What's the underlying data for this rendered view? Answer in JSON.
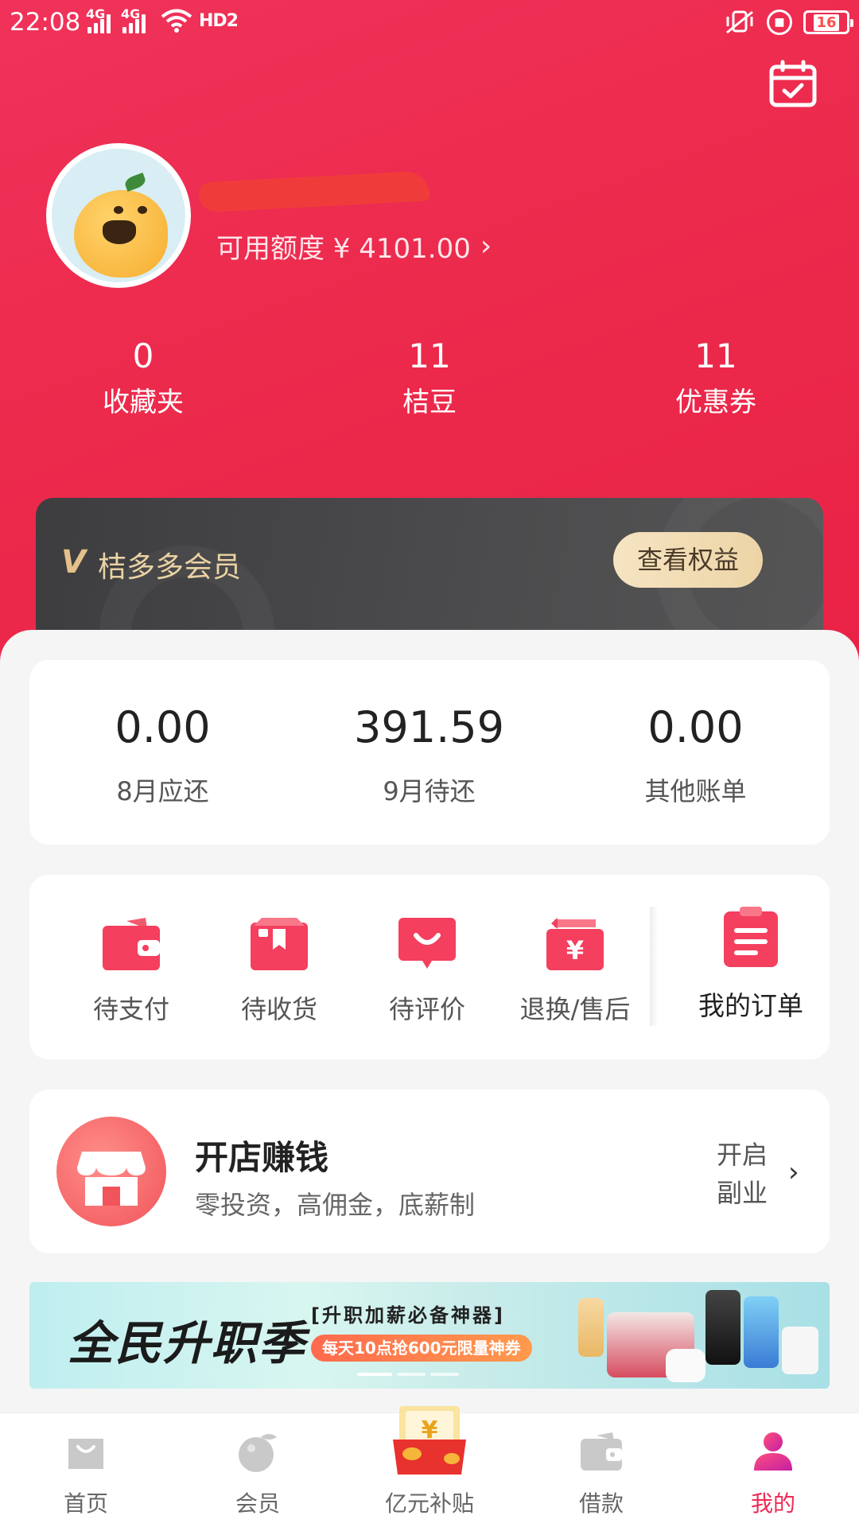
{
  "status_bar": {
    "time": "22:08",
    "signal_1": "4G",
    "signal_2": "4G",
    "hd": "HD2",
    "battery": "16"
  },
  "header": {
    "calendar_icon": "calendar-check-icon",
    "credit_label": "可用额度 ¥ 4101.00",
    "chevron": "›"
  },
  "stats": [
    {
      "value": "0",
      "label": "收藏夹"
    },
    {
      "value": "11",
      "label": "桔豆"
    },
    {
      "value": "11",
      "label": "优惠券"
    }
  ],
  "vip": {
    "logo": "V",
    "title": "桔多多会员",
    "button": "查看权益"
  },
  "bills": [
    {
      "amount": "0.00",
      "label": "8月应还"
    },
    {
      "amount": "391.59",
      "label": "9月待还"
    },
    {
      "amount": "0.00",
      "label": "其他账单"
    }
  ],
  "orders": {
    "items": [
      {
        "label": "待支付",
        "icon": "wallet-icon"
      },
      {
        "label": "待收货",
        "icon": "package-icon"
      },
      {
        "label": "待评价",
        "icon": "comment-icon"
      },
      {
        "label": "退换/售后",
        "icon": "refund-icon"
      }
    ],
    "my_orders": "我的订单"
  },
  "shop": {
    "title": "开店赚钱",
    "subtitle": "零投资，高佣金，底薪制",
    "action_line1": "开启",
    "action_line2": "副业",
    "chevron": "›"
  },
  "banner": {
    "title": "全民升职季",
    "subtitle": "[升职加薪必备神器]",
    "tag": "每天10点抢600元限量神券"
  },
  "tabbar": [
    {
      "label": "首页",
      "icon": "shopping-bag-icon",
      "active": false
    },
    {
      "label": "会员",
      "icon": "orange-icon",
      "active": false
    },
    {
      "label": "亿元补贴",
      "icon": "red-envelope-icon",
      "active": false
    },
    {
      "label": "借款",
      "icon": "wallet-icon",
      "active": false
    },
    {
      "label": "我的",
      "icon": "user-icon",
      "active": true
    }
  ],
  "colors": {
    "brand": "#ee2b55",
    "vip_gold": "#ead2a4"
  }
}
